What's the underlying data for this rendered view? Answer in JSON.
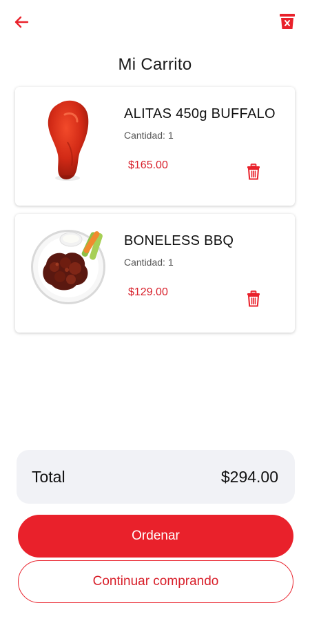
{
  "colors": {
    "accent": "#e9212b",
    "price": "#d81f2a",
    "total_bg": "#f1f2f6"
  },
  "header": {
    "back_icon": "arrow-left-icon",
    "clear_icon": "trash-x-icon",
    "title": "Mi Carrito"
  },
  "cart": {
    "items": [
      {
        "name": "ALITAS 450g BUFFALO",
        "quantity_label": "Cantidad:",
        "quantity": "1",
        "price": "$165.00",
        "image": "buffalo-wing-image",
        "delete_icon": "trash-icon"
      },
      {
        "name": "BONELESS BBQ",
        "quantity_label": "Cantidad:",
        "quantity": "1",
        "price": "$129.00",
        "image": "boneless-bbq-plate-image",
        "delete_icon": "trash-icon"
      }
    ]
  },
  "summary": {
    "total_label": "Total",
    "total_value": "$294.00"
  },
  "actions": {
    "order_label": "Ordenar",
    "continue_label": "Continuar comprando"
  }
}
